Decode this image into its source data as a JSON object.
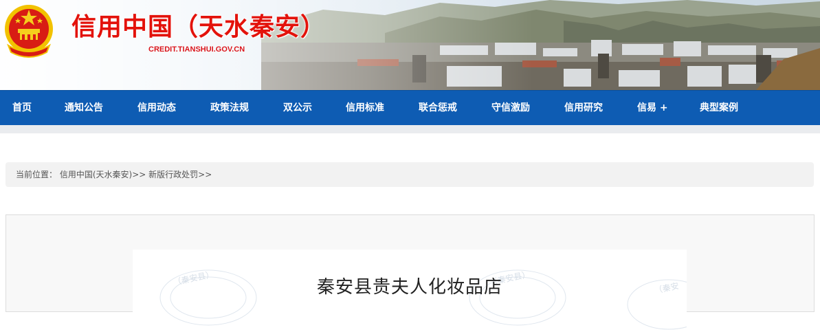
{
  "header": {
    "site_title": "信用中国（天水秦安）",
    "domain": "CREDIT.TIANSHUI.GOV.CN",
    "emblem_icon": "national-emblem-icon"
  },
  "nav": {
    "items": [
      {
        "label": "首页"
      },
      {
        "label": "通知公告"
      },
      {
        "label": "信用动态"
      },
      {
        "label": "政策法规"
      },
      {
        "label": "双公示"
      },
      {
        "label": "信用标准"
      },
      {
        "label": "联合惩戒"
      },
      {
        "label": "守信激励"
      },
      {
        "label": "信用研究"
      },
      {
        "label": "信易 +"
      },
      {
        "label": "典型案例"
      }
    ]
  },
  "breadcrumb": {
    "prefix": "当前位置：",
    "items": [
      "信用中国(天水秦安)",
      "新版行政处罚"
    ],
    "separator": ">>"
  },
  "content": {
    "title": "秦安县贵夫人化妆品店",
    "watermark_text": "（秦安县）"
  },
  "colors": {
    "nav_bg": "#0e5cb3",
    "title_red": "#e3120b",
    "breadcrumb_bg": "#f2f2f2"
  }
}
